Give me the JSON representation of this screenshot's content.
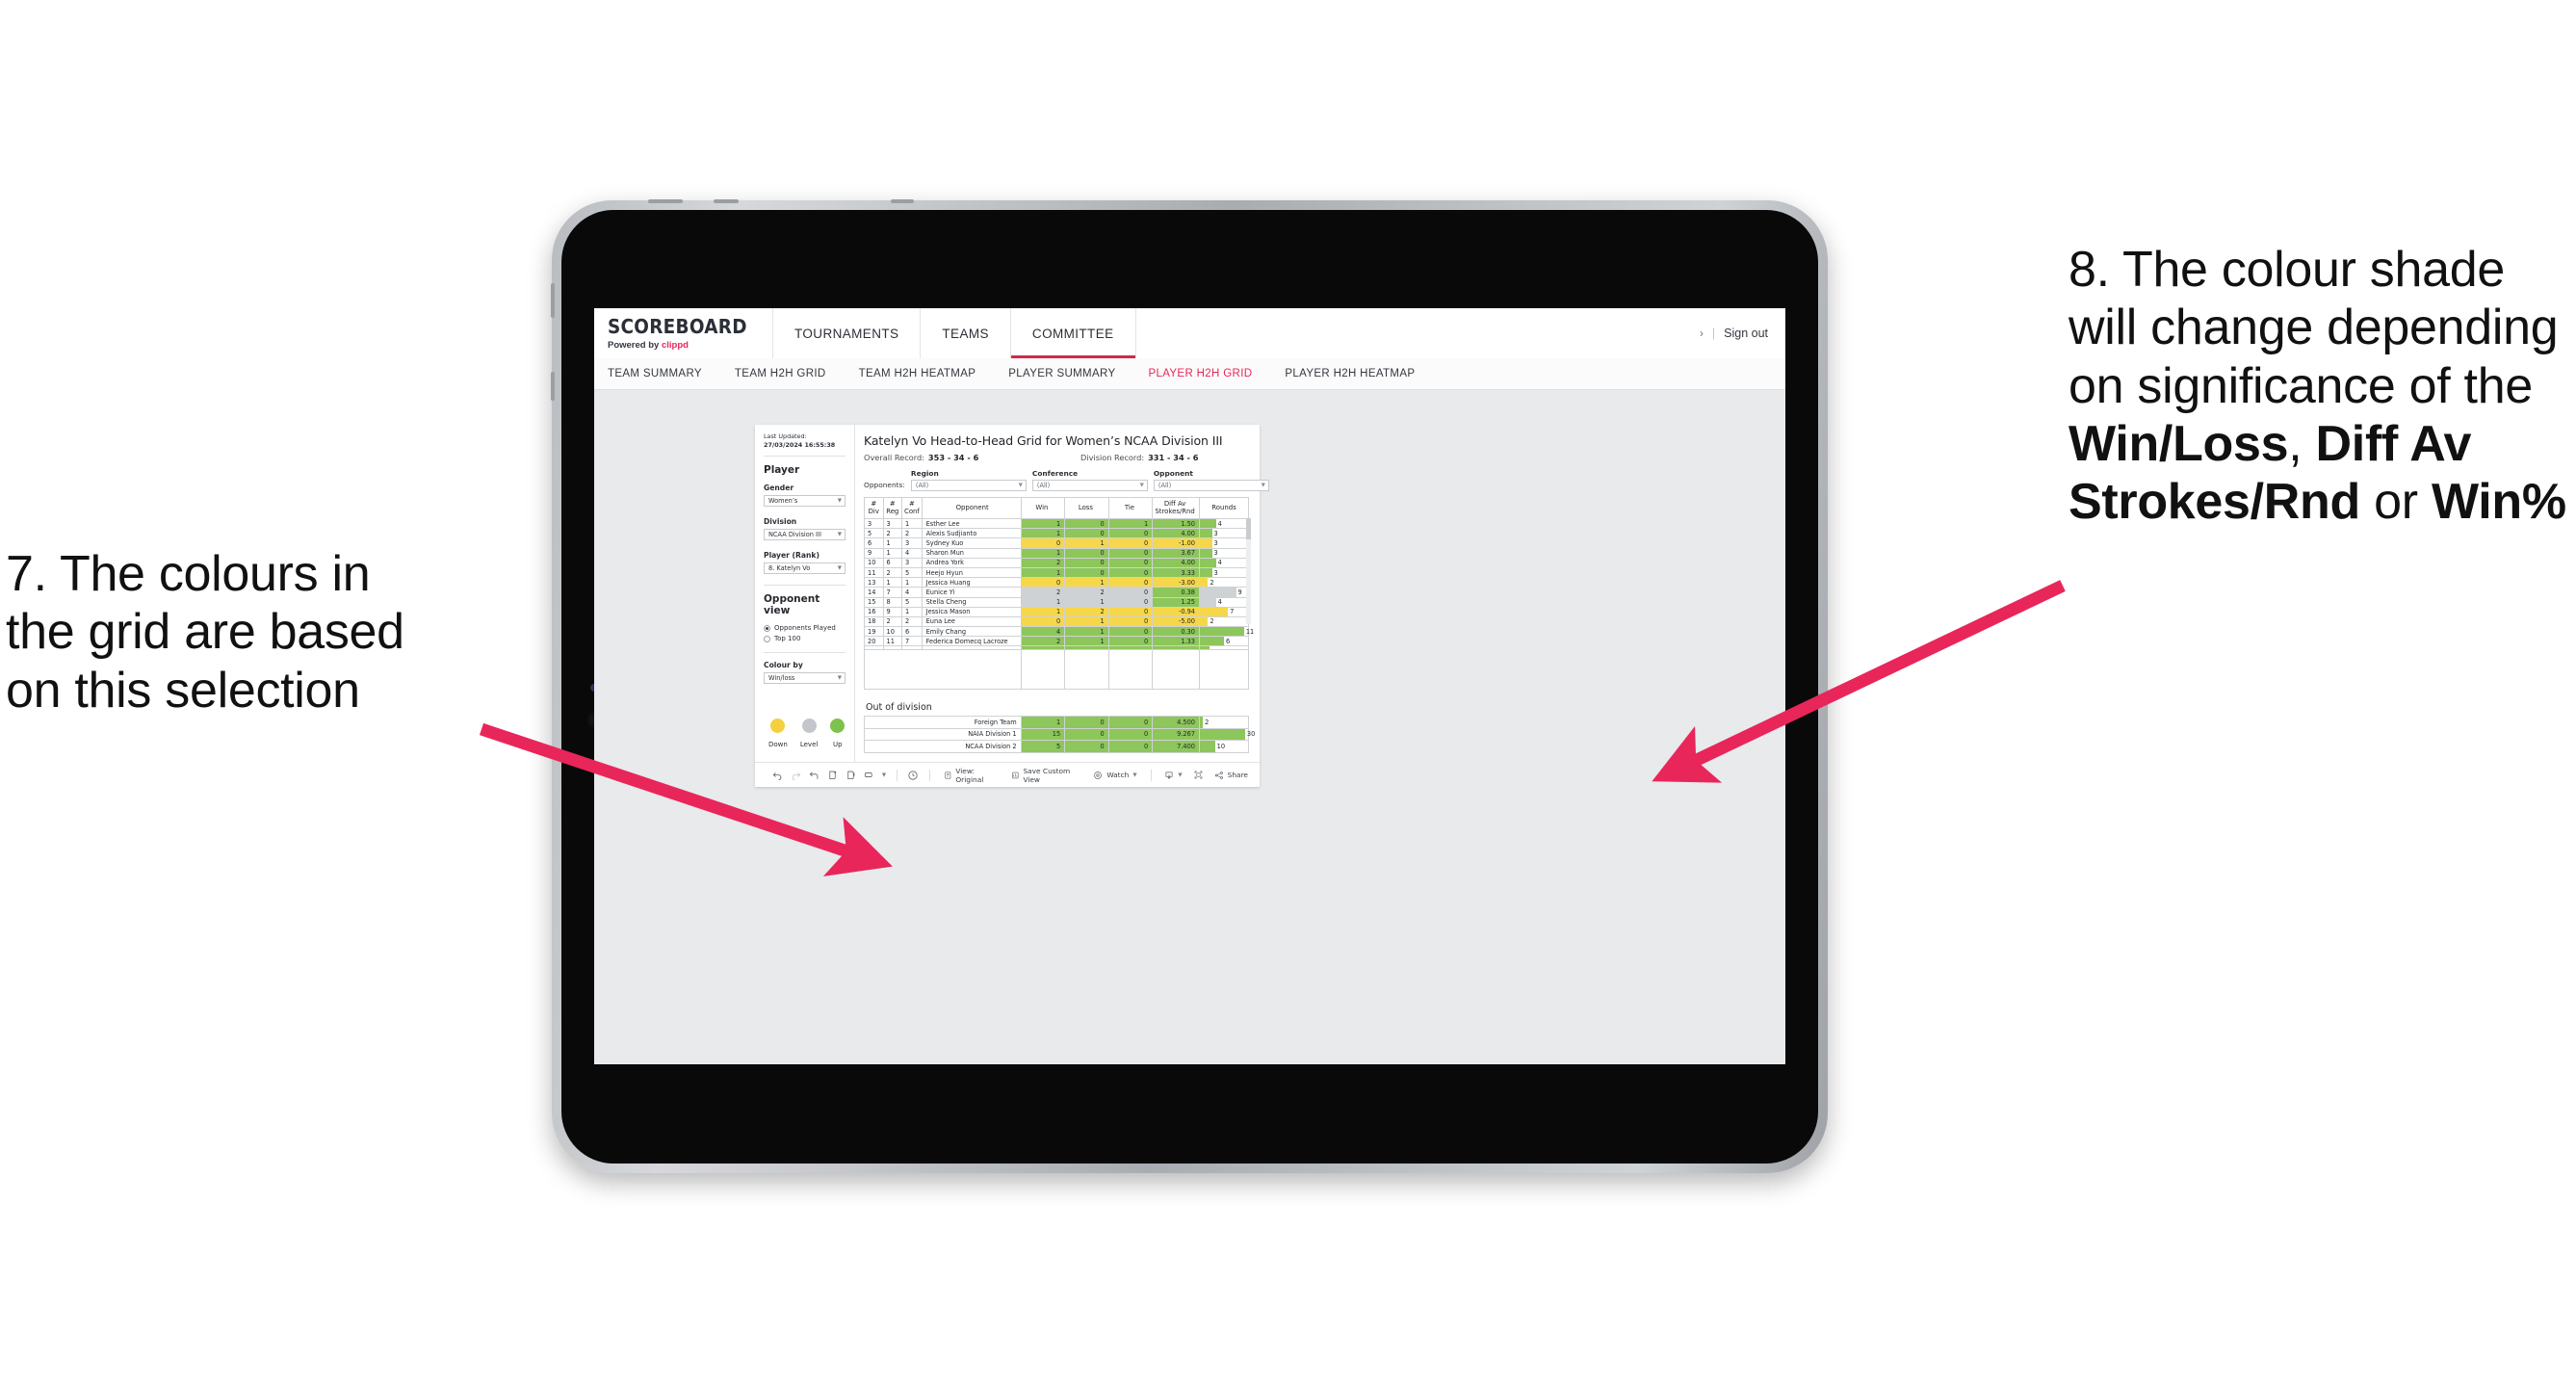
{
  "annotations": {
    "left": {
      "lines": [
        "7. The colours in",
        "the grid are based",
        "on this selection"
      ]
    },
    "right": {
      "pre": "8. The colour shade will change depending on significance of the ",
      "b1": "Win/Loss",
      "mid1": ", ",
      "b2": "Diff Av Strokes/Rnd",
      "mid2": " or ",
      "b3": "Win%"
    },
    "arrow_color": "#e8265a"
  },
  "app": {
    "brand": {
      "title": "SCOREBOARD",
      "powered_prefix": "Powered by ",
      "powered_name": "clippd"
    },
    "topnav": [
      {
        "label": "TOURNAMENTS",
        "active": false
      },
      {
        "label": "TEAMS",
        "active": false
      },
      {
        "label": "COMMITTEE",
        "active": true
      }
    ],
    "signout": {
      "chevron": "›",
      "divider": "|",
      "label": "Sign out"
    },
    "subnav": [
      {
        "label": "TEAM SUMMARY",
        "active": false
      },
      {
        "label": "TEAM H2H GRID",
        "active": false
      },
      {
        "label": "TEAM H2H HEATMAP",
        "active": false
      },
      {
        "label": "PLAYER SUMMARY",
        "active": false
      },
      {
        "label": "PLAYER H2H GRID",
        "active": true
      },
      {
        "label": "PLAYER H2H HEATMAP",
        "active": false
      }
    ],
    "sidebar": {
      "last_updated_label": "Last Updated: ",
      "last_updated_value": "27/03/2024 16:55:38",
      "player_heading": "Player",
      "fields": [
        {
          "label": "Gender",
          "value": "Women’s"
        },
        {
          "label": "Division",
          "value": "NCAA Division III"
        },
        {
          "label": "Player (Rank)",
          "value": "8. Katelyn Vo"
        }
      ],
      "opponent_view_heading": "Opponent view",
      "opponent_view_options": [
        {
          "label": "Opponents Played",
          "selected": true
        },
        {
          "label": "Top 100",
          "selected": false
        }
      ],
      "colour_by_label": "Colour by",
      "colour_by_value": "Win/loss",
      "legend": [
        {
          "label": "Down",
          "color": "#f4d03f"
        },
        {
          "label": "Level",
          "color": "#c3c7cb"
        },
        {
          "label": "Up",
          "color": "#7dc24b"
        }
      ]
    },
    "main": {
      "title": "Katelyn Vo Head-to-Head Grid for Women’s NCAA Division III",
      "overall_record_label": "Overall Record: ",
      "overall_record_value": "353 -  34 - 6",
      "division_record_label": "Division Record: ",
      "division_record_value": "331 -  34 - 6",
      "opponents_label": "Opponents:",
      "filters": [
        {
          "caption": "Region",
          "value": "(All)"
        },
        {
          "caption": "Conference",
          "value": "(All)"
        },
        {
          "caption": "Opponent",
          "value": "(All)"
        }
      ],
      "out_of_division_title": "Out of division"
    },
    "toolbar": {
      "icons": [
        "undo-icon",
        "redo-icon",
        "revert-icon",
        "refresh-icon",
        "pause-icon",
        "shape-icon",
        "caret-icon"
      ],
      "presentation_icon": "presentation-icon",
      "view_label": "View: Original",
      "save_label": "Save Custom View",
      "watch_label": "Watch",
      "download_icon": "download-icon",
      "fullscreen_icon": "fullscreen-icon",
      "share_label": "Share"
    }
  },
  "chart_data": {
    "type": "table",
    "title": "Katelyn Vo Head-to-Head Grid for Women’s NCAA Division III",
    "columns": [
      "# Div",
      "# Reg",
      "# Conf",
      "Opponent",
      "Win",
      "Loss",
      "Tie",
      "Diff Av Strokes/Rnd",
      "Rounds"
    ],
    "column_headers_multiline": [
      [
        "#",
        "Div"
      ],
      [
        "#",
        "Reg"
      ],
      [
        "#",
        "Conf"
      ],
      [
        "",
        "Opponent"
      ],
      [
        "",
        "Win"
      ],
      [
        "",
        "Loss"
      ],
      [
        "",
        "Tie"
      ],
      [
        "Diff Av",
        "Strokes/Rnd"
      ],
      [
        "",
        "Rounds"
      ]
    ],
    "rounds_max": 12,
    "colors": {
      "up": "#8dc65a",
      "down": "#f6d749",
      "level": "#cfd2d5"
    },
    "rows": [
      {
        "div": "3",
        "reg": "3",
        "conf": "1",
        "opponent": "Esther Lee",
        "win": "1",
        "loss": "0",
        "tie": "1",
        "diff": "1.50",
        "rounds": "4",
        "status": "up"
      },
      {
        "div": "5",
        "reg": "2",
        "conf": "2",
        "opponent": "Alexis Sudjianto",
        "win": "1",
        "loss": "0",
        "tie": "0",
        "diff": "4.00",
        "rounds": "3",
        "status": "up"
      },
      {
        "div": "6",
        "reg": "1",
        "conf": "3",
        "opponent": "Sydney Kuo",
        "win": "0",
        "loss": "1",
        "tie": "0",
        "diff": "-1.00",
        "rounds": "3",
        "status": "down"
      },
      {
        "div": "9",
        "reg": "1",
        "conf": "4",
        "opponent": "Sharon Mun",
        "win": "1",
        "loss": "0",
        "tie": "0",
        "diff": "3.67",
        "rounds": "3",
        "status": "up"
      },
      {
        "div": "10",
        "reg": "6",
        "conf": "3",
        "opponent": "Andrea York",
        "win": "2",
        "loss": "0",
        "tie": "0",
        "diff": "4.00",
        "rounds": "4",
        "status": "up"
      },
      {
        "div": "11",
        "reg": "2",
        "conf": "5",
        "opponent": "Heejo Hyun",
        "win": "1",
        "loss": "0",
        "tie": "0",
        "diff": "3.33",
        "rounds": "3",
        "status": "up"
      },
      {
        "div": "13",
        "reg": "1",
        "conf": "1",
        "opponent": "Jessica Huang",
        "win": "0",
        "loss": "1",
        "tie": "0",
        "diff": "-3.00",
        "rounds": "2",
        "status": "down"
      },
      {
        "div": "14",
        "reg": "7",
        "conf": "4",
        "opponent": "Eunice Yi",
        "win": "2",
        "loss": "2",
        "tie": "0",
        "diff": "0.38",
        "rounds": "9",
        "status": "level",
        "diff_status": "up"
      },
      {
        "div": "15",
        "reg": "8",
        "conf": "5",
        "opponent": "Stella Cheng",
        "win": "1",
        "loss": "1",
        "tie": "0",
        "diff": "1.25",
        "rounds": "4",
        "status": "level",
        "diff_status": "up"
      },
      {
        "div": "16",
        "reg": "9",
        "conf": "1",
        "opponent": "Jessica Mason",
        "win": "1",
        "loss": "2",
        "tie": "0",
        "diff": "-0.94",
        "rounds": "7",
        "status": "down"
      },
      {
        "div": "18",
        "reg": "2",
        "conf": "2",
        "opponent": "Euna Lee",
        "win": "0",
        "loss": "1",
        "tie": "0",
        "diff": "-5.00",
        "rounds": "2",
        "status": "down"
      },
      {
        "div": "19",
        "reg": "10",
        "conf": "6",
        "opponent": "Emily Chang",
        "win": "4",
        "loss": "1",
        "tie": "0",
        "diff": "0.30",
        "rounds": "11",
        "status": "up"
      },
      {
        "div": "20",
        "reg": "11",
        "conf": "7",
        "opponent": "Federica Domecq Lacroze",
        "win": "2",
        "loss": "1",
        "tie": "0",
        "diff": "1.33",
        "rounds": "6",
        "status": "up"
      }
    ],
    "out_of_division": {
      "rounds_max": 32,
      "rows": [
        {
          "name": "Foreign Team",
          "win": "1",
          "loss": "0",
          "tie": "0",
          "diff": "4.500",
          "rounds": "2",
          "status": "up"
        },
        {
          "name": "NAIA Division 1",
          "win": "15",
          "loss": "0",
          "tie": "0",
          "diff": "9.267",
          "rounds": "30",
          "status": "up"
        },
        {
          "name": "NCAA Division 2",
          "win": "5",
          "loss": "0",
          "tie": "0",
          "diff": "7.400",
          "rounds": "10",
          "status": "up"
        }
      ]
    }
  }
}
